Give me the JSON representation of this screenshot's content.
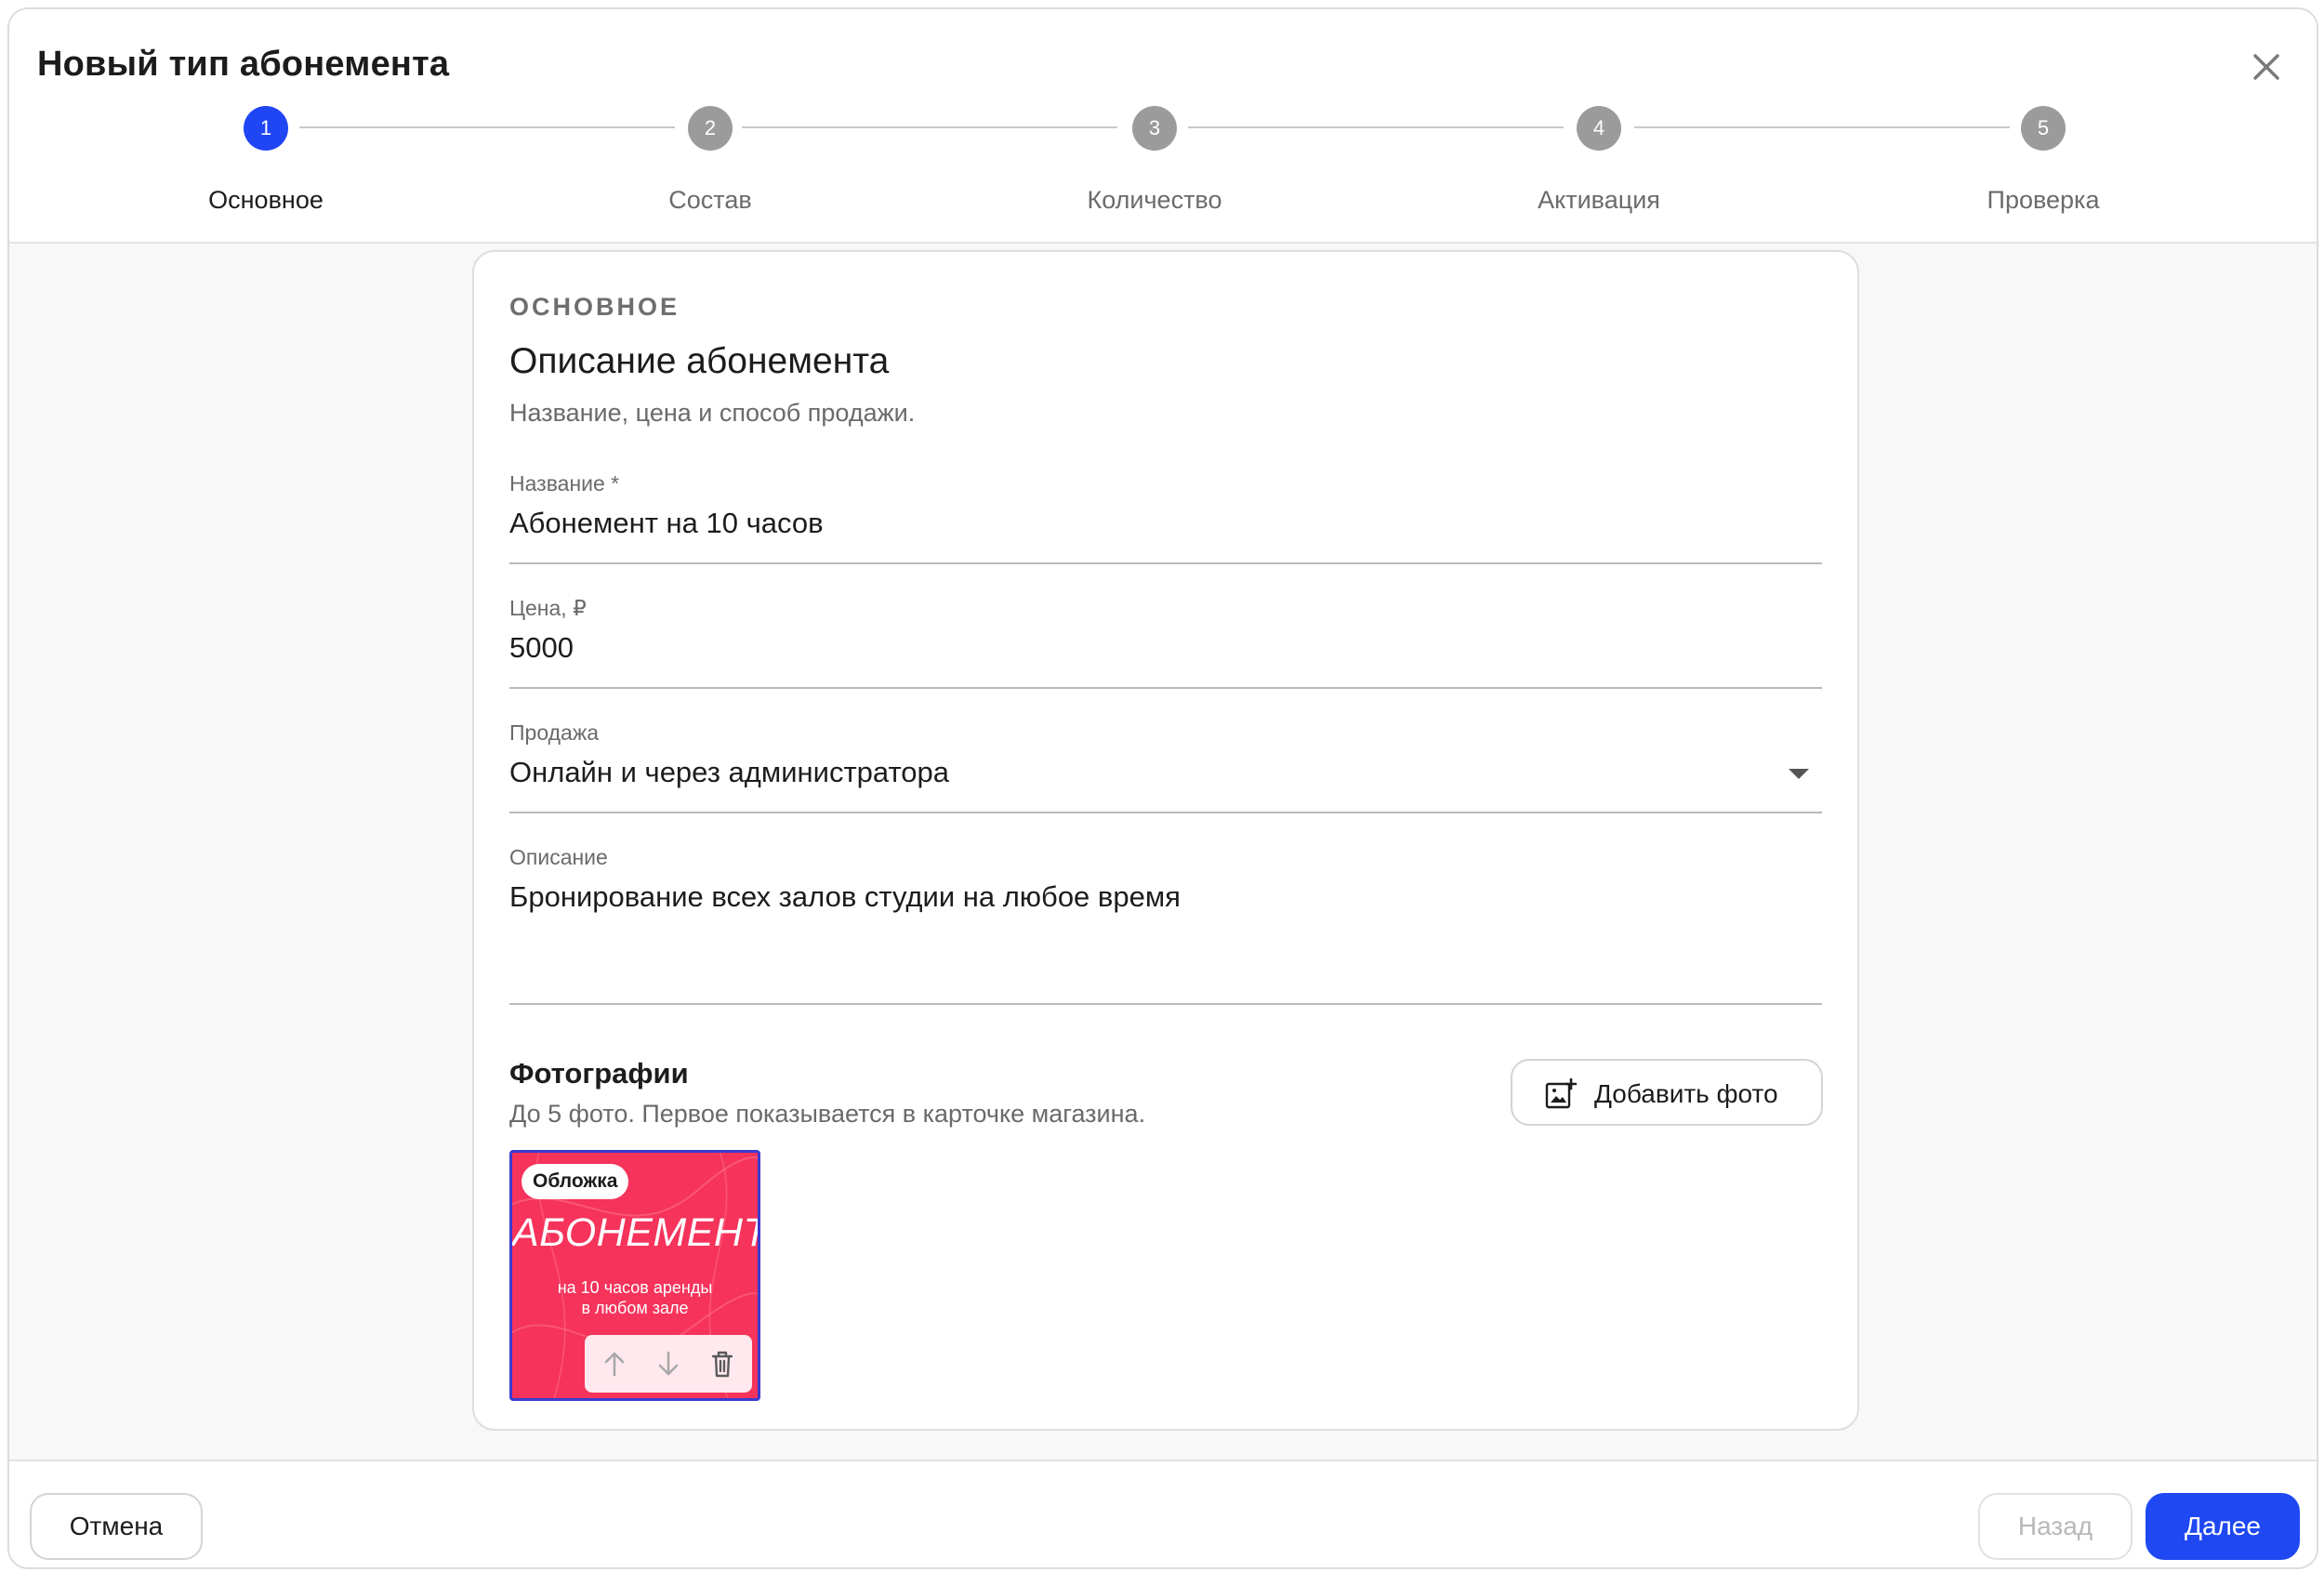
{
  "dialog": {
    "title": "Новый тип абонемента"
  },
  "stepper": {
    "active_step": 1,
    "steps": [
      {
        "number": "1",
        "label": "Основное"
      },
      {
        "number": "2",
        "label": "Состав"
      },
      {
        "number": "3",
        "label": "Количество"
      },
      {
        "number": "4",
        "label": "Активация"
      },
      {
        "number": "5",
        "label": "Проверка"
      }
    ]
  },
  "section": {
    "tag": "ОСНОВНОЕ",
    "title": "Описание абонемента",
    "subtitle": "Название, цена и способ продажи."
  },
  "fields": {
    "name": {
      "label": "Название *",
      "value": "Абонемент на 10 часов"
    },
    "price": {
      "label": "Цена, ₽",
      "value": "5000"
    },
    "sale": {
      "label": "Продажа",
      "value": "Онлайн и через администратора"
    },
    "description": {
      "label": "Описание",
      "value": "Бронирование всех залов студии на любое время"
    }
  },
  "photos": {
    "title": "Фотографии",
    "subtitle": "До 5 фото. Первое показывается в карточке магазина.",
    "add_button_label": "Добавить фото",
    "items": [
      {
        "badge": "Обложка",
        "promo_title": "АБОНЕМЕНТ",
        "promo_line1": "на 10 часов аренды",
        "promo_line2": "в любом зале",
        "background_color": "#f5335b",
        "actions": [
          "arrow-up-icon",
          "arrow-down-icon",
          "trash-icon"
        ]
      }
    ]
  },
  "footer": {
    "cancel_label": "Отмена",
    "back_label": "Назад",
    "next_label": "Далее"
  },
  "colors": {
    "accent": "#1f48f2",
    "step_active": "#2045f5",
    "step_inactive": "#9b9b9b"
  }
}
